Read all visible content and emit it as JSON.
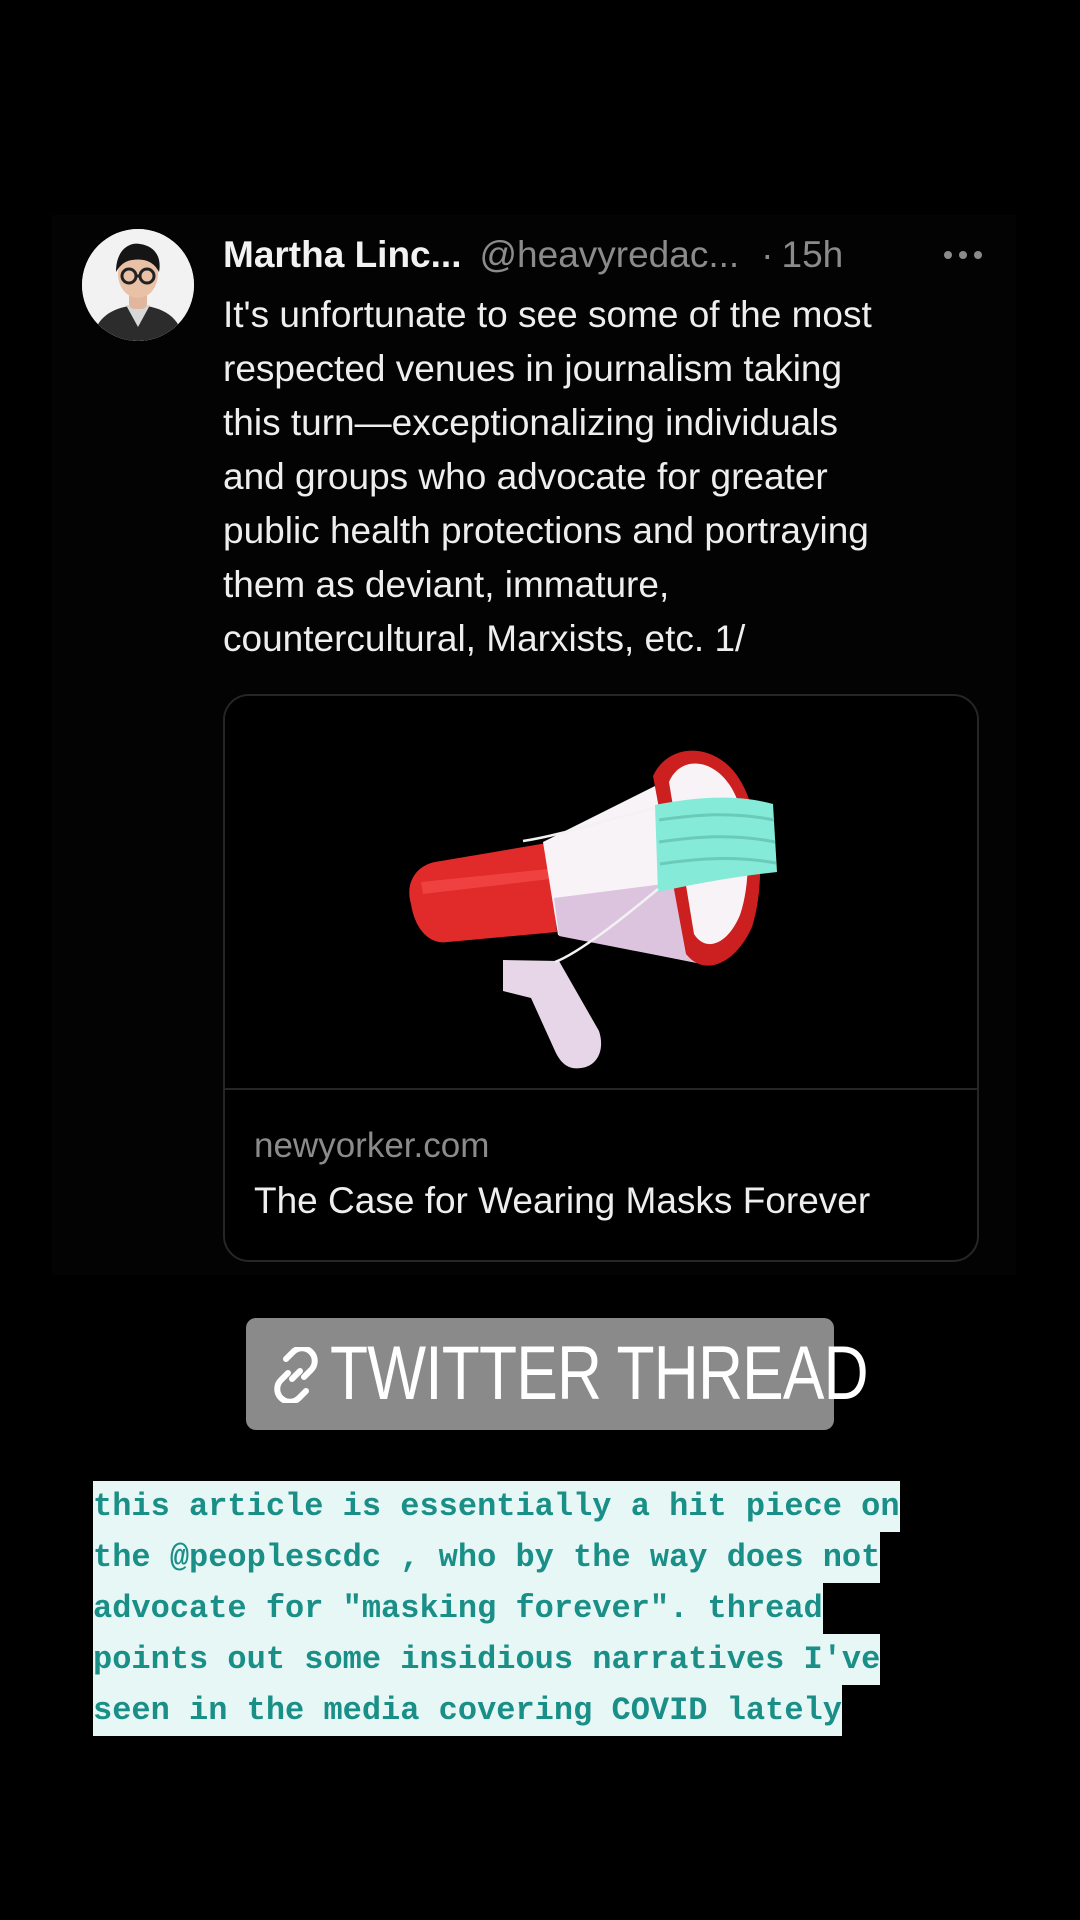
{
  "tweet": {
    "author_name": "Martha Linc...",
    "author_handle": "@heavyredac...",
    "separator": "·",
    "time": "15h",
    "text": "It's unfortunate to see some of the most\nrespected venues in journalism taking\nthis turn—exceptionalizing individuals\nand groups who advocate for greater\npublic health protections and portraying\nthem as deviant, immature,\ncountercultural, Marxists, etc. 1/",
    "link_preview": {
      "domain": "newyorker.com",
      "title": "The Case for Wearing Masks Forever",
      "image": "megaphone-with-face-mask-illustration"
    }
  },
  "sticker": {
    "icon": "link-icon",
    "label": "TWITTER THREAD"
  },
  "caption": {
    "lines": [
      "this article is essentially a hit piece on",
      "the @peoplescdc , who by the way does not",
      "advocate for \"masking forever\". thread",
      "points out some insidious narratives I've",
      "seen in the media covering COVID lately"
    ]
  },
  "colors": {
    "background": "#000000",
    "caption_text": "#1a8f87",
    "caption_highlight": "#e6f7f6",
    "sticker_background": "#8a8a8a",
    "muted_text": "#8b8b8b"
  }
}
